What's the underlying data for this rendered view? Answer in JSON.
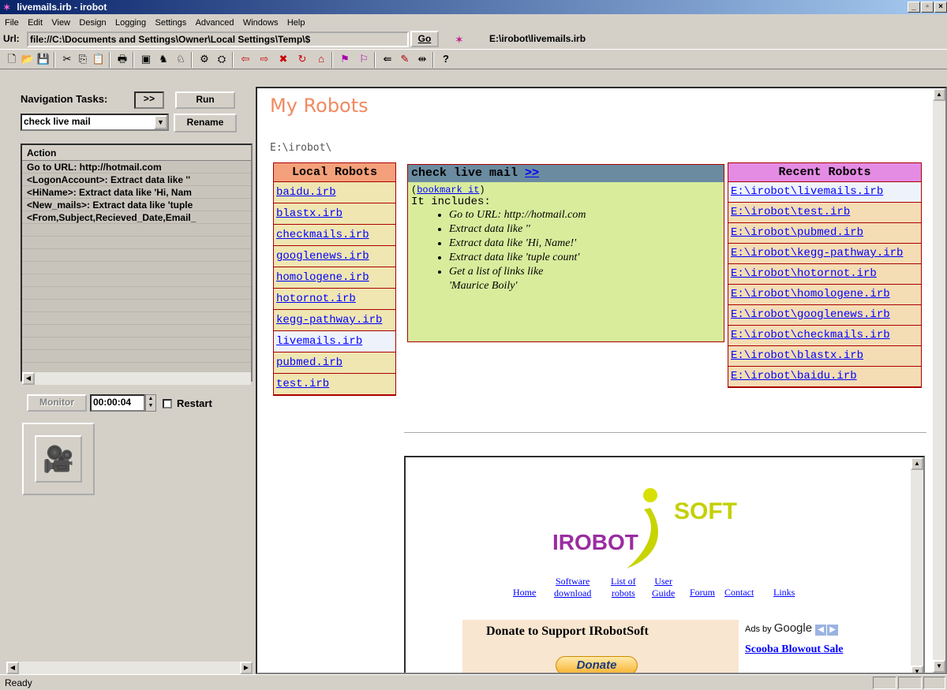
{
  "window": {
    "title": "livemails.irb - irobot",
    "controls": [
      "_",
      "▫",
      "×"
    ]
  },
  "menu": [
    "File",
    "Edit",
    "View",
    "Design",
    "Logging",
    "Settings",
    "Advanced",
    "Windows",
    "Help"
  ],
  "urlbar": {
    "label": "Url:",
    "value": "file://C:\\Documents and Settings\\Owner\\Local Settings\\Temp\\$",
    "go_label": "Go",
    "current_file": "E:\\irobot\\livemails.irb"
  },
  "toolbar": {
    "icons": [
      "new-icon",
      "open-icon",
      "save-icon",
      "cut-icon",
      "copy-icon",
      "paste-icon",
      "print-icon",
      "window-icon",
      "robot-run-icon",
      "robot-step-icon",
      "record-icon",
      "extract-icon",
      "back-icon",
      "forward-icon",
      "stop-icon",
      "refresh-icon",
      "home-icon",
      "add-task-icon",
      "remove-task-icon",
      "link-icon",
      "edit-icon",
      "jump-icon",
      "help-icon"
    ]
  },
  "left": {
    "nav_label": "Navigation Tasks:",
    "nav_toggle": ">>",
    "run_label": "Run",
    "task_selected": "check live mail",
    "rename_label": "Rename",
    "action_header": "Action",
    "actions": [
      "Go to URL: http://hotmail.com",
      "<LogonAccount>: Extract data like ''",
      "<HiName>: Extract data like 'Hi, Nam",
      "<New_mails>: Extract data like 'tuple",
      "<From,Subject,Recieved_Date,Email_"
    ],
    "monitor_label": "Monitor",
    "timer_value": "00:00:04",
    "restart_label": "Restart"
  },
  "page": {
    "title": "My Robots",
    "base_path": "E:\\irobot\\",
    "local_header": "Local Robots",
    "local_robots": [
      "baidu.irb",
      "blastx.irb",
      "checkmails.irb",
      "googlenews.irb",
      "homologene.irb",
      "hotornot.irb",
      "kegg-pathway.irb",
      "livemails.irb",
      "pubmed.irb",
      "test.irb"
    ],
    "local_selected_index": 7,
    "detail": {
      "task_name": "check live mail",
      "task_arrow": ">>",
      "bookmark_prefix": "(",
      "bookmark_link": "bookmark it",
      "bookmark_suffix": ")",
      "includes_label": "It includes:",
      "items": [
        "Go to URL: http://hotmail.com",
        "Extract data like ''",
        "Extract data like 'Hi, Name!'",
        "Extract data like 'tuple count'",
        "Get a list of links like"
      ],
      "items_cont": "'Maurice Boily'"
    },
    "recent_header": "Recent Robots",
    "recent_robots": [
      "E:\\irobot\\livemails.irb",
      "E:\\irobot\\test.irb",
      "E:\\irobot\\pubmed.irb",
      "E:\\irobot\\kegg-pathway.irb",
      "E:\\irobot\\hotornot.irb",
      "E:\\irobot\\homologene.irb",
      "E:\\irobot\\googlenews.irb",
      "E:\\irobot\\checkmails.irb",
      "E:\\irobot\\blastx.irb",
      "E:\\irobot\\baidu.irb"
    ],
    "recent_selected_index": 0
  },
  "embedded": {
    "logo_left": "IROBOT",
    "logo_right": "SOFT",
    "nav": {
      "home": "Home",
      "software_line1": "Software",
      "software_line2": "download",
      "listof_line1": "List of",
      "listof_line2": "robots",
      "user_line1": "User",
      "user_line2": "Guide",
      "forum": "Forum",
      "contact": "Contact",
      "links": "Links"
    },
    "donate_title": "Donate to Support IRobotSoft",
    "donate_button": "Donate",
    "ads_by": "Ads by",
    "ads_google": "Google",
    "ad_link": "Scooba Blowout Sale"
  },
  "status": {
    "text": "Ready"
  },
  "colors": {
    "title_accent": "#f08a60",
    "local_header_bg": "#f4a07a",
    "recent_header_bg": "#e48be4",
    "detail_bg": "#d9ec9c",
    "link": "#0000ff"
  }
}
